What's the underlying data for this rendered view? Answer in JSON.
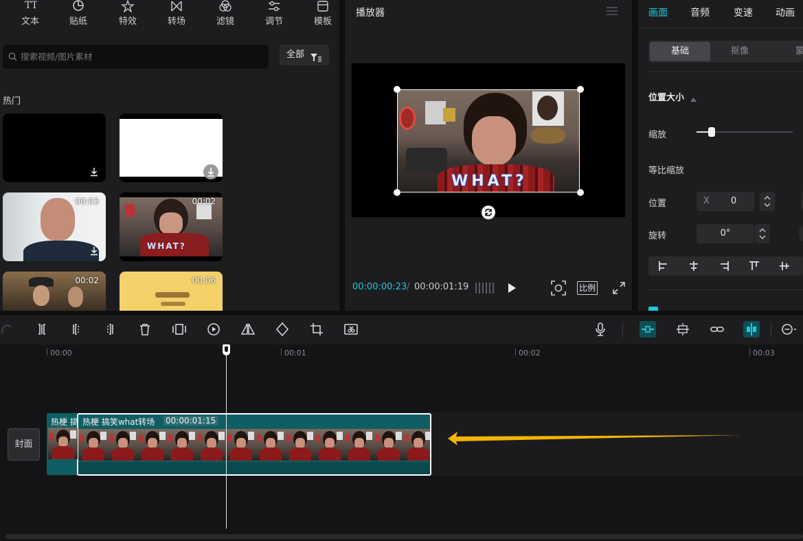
{
  "toolbar": {
    "categories": [
      {
        "label": "文本",
        "icon": "text-icon"
      },
      {
        "label": "贴纸",
        "icon": "sticker-icon"
      },
      {
        "label": "特效",
        "icon": "effects-icon"
      },
      {
        "label": "转场",
        "icon": "transition-icon"
      },
      {
        "label": "滤镜",
        "icon": "filter-icon"
      },
      {
        "label": "调节",
        "icon": "adjust-icon"
      },
      {
        "label": "模板",
        "icon": "template-icon"
      }
    ]
  },
  "library": {
    "search_placeholder": "搜索视频/图片素材",
    "filter_label": "全部",
    "section_title": "热门",
    "items": [
      {
        "type": "black",
        "duration": ""
      },
      {
        "type": "white",
        "duration": ""
      },
      {
        "type": "man",
        "duration": "00:03"
      },
      {
        "type": "what",
        "duration": "00:02"
      },
      {
        "type": "crowd",
        "duration": "00:02"
      },
      {
        "type": "yellow",
        "duration": "00:06"
      }
    ]
  },
  "player": {
    "title": "播放器",
    "current_time": "00:00:00:23",
    "total_time": "00:00:01:19",
    "ratio_label": "比例",
    "video_caption": "WHAT?"
  },
  "properties": {
    "tabs": [
      "画面",
      "音频",
      "变速",
      "动画"
    ],
    "active_tab": "画面",
    "sub_tabs": [
      "基础",
      "抠像",
      "蒙"
    ],
    "section_title": "位置大小",
    "scale_label": "缩放",
    "scale_value_fraction": 0.16,
    "uniform_label": "等比缩放",
    "position_label": "位置",
    "position_x_label": "X",
    "position_x_value": "0",
    "rotation_label": "旋转",
    "rotation_value": "0°"
  },
  "timeline": {
    "ticks": [
      "00:00",
      "00:01",
      "00:02",
      "00:03"
    ],
    "cover_label": "封面",
    "clip_a_label": "热梗 搞",
    "clip_b_label": "热梗 搞笑what转场",
    "clip_b_duration": "00:00:01:15"
  },
  "colors": {
    "accent": "#1fc9d9",
    "clip_bg": "#0f5e63",
    "arrow": "#f5b400"
  }
}
